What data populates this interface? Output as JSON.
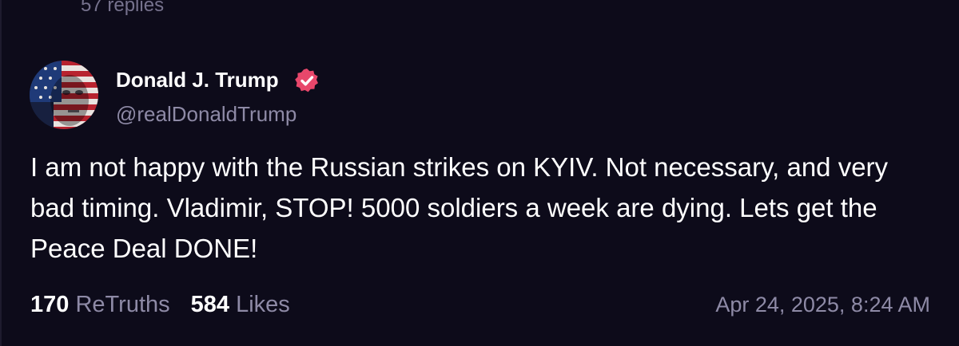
{
  "previous_post": {
    "replies_label": "57 replies"
  },
  "post": {
    "author": {
      "display_name": "Donald J. Trump",
      "handle": "@realDonaldTrump",
      "verified": true,
      "badge_color": "#e8476b"
    },
    "text": "I am not happy with the Russian strikes on KYIV. Not necessary, and very bad timing. Vladimir, STOP! 5000 soldiers a week are dying. Lets get the Peace Deal DONE!",
    "stats": {
      "retruths_count": "170",
      "retruths_label": "ReTruths",
      "likes_count": "584",
      "likes_label": "Likes"
    },
    "timestamp": "Apr 24, 2025, 8:24 AM"
  },
  "colors": {
    "background": "#0d0b1a",
    "primary_text": "#ffffff",
    "secondary_text": "#8e8aa6"
  }
}
